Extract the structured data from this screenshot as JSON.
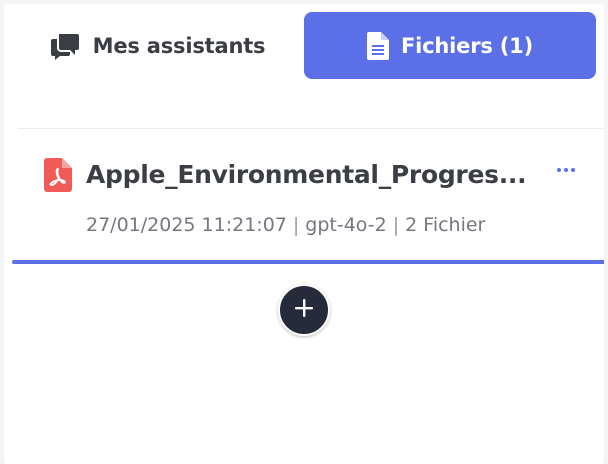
{
  "tabs": {
    "assistants": {
      "label": "Mes assistants",
      "icon": "chat-bubbles-icon"
    },
    "files": {
      "label": "Fichiers (1)",
      "icon": "document-icon",
      "active": true
    }
  },
  "file": {
    "name": "Apple_Environmental_Progres...",
    "icon": "pdf-icon",
    "date": "27/01/2025 11:21:07",
    "model": "gpt-4o-2",
    "count": "2 Fichier"
  },
  "actions": {
    "more_icon": "more-horizontal-icon",
    "add_icon": "plus-icon"
  },
  "colors": {
    "accent": "#5b6fe6",
    "pdf_red": "#f05b57",
    "dark_button": "#262a3b",
    "text_dark": "#3c3e46",
    "text_muted": "#75777f"
  }
}
